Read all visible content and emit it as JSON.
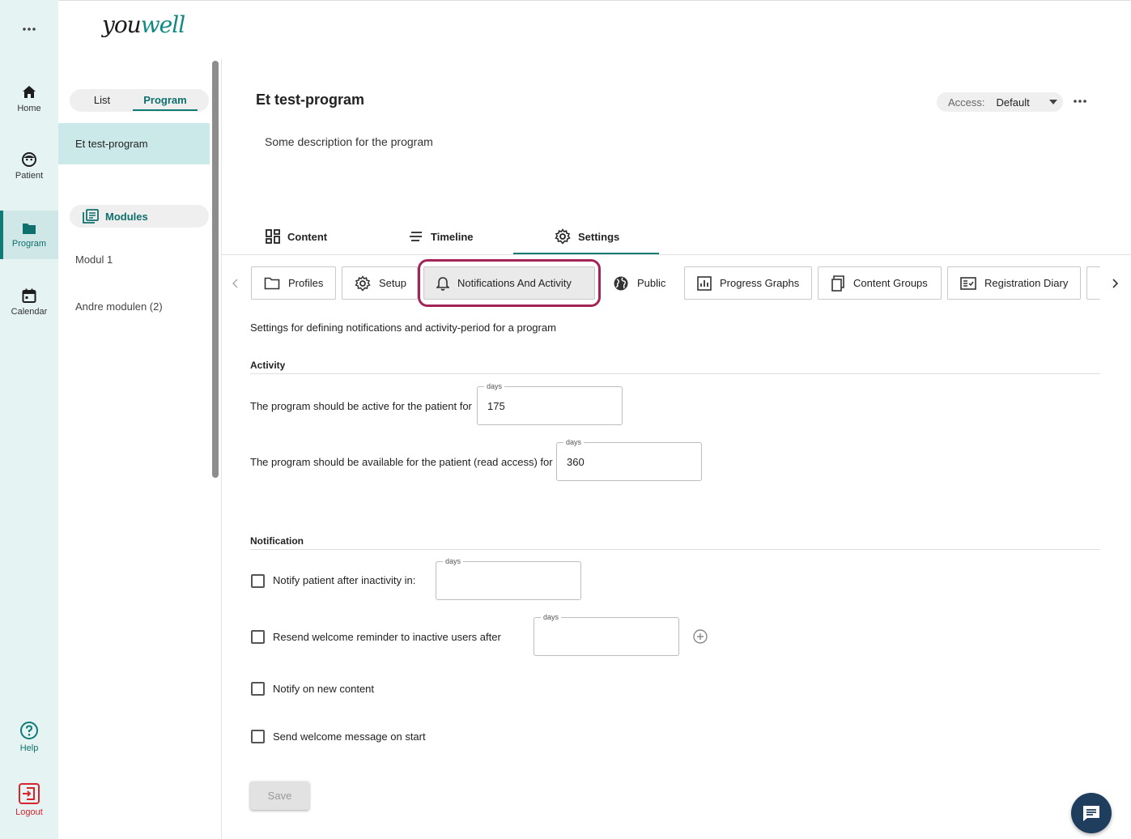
{
  "brand": {
    "logo_text_left": "you",
    "logo_text_right": "well",
    "color_dark": "#1a1a1a",
    "color_accent": "#0f8a83"
  },
  "rail": {
    "items": [
      {
        "label": "Home",
        "icon": "home-icon"
      },
      {
        "label": "Patient",
        "icon": "patient-face-icon"
      },
      {
        "label": "Program",
        "icon": "folder-icon",
        "active": true
      },
      {
        "label": "Calendar",
        "icon": "calendar-icon"
      }
    ],
    "help_label": "Help",
    "logout_label": "Logout"
  },
  "panel": {
    "toggle": {
      "list_label": "List",
      "program_label": "Program",
      "selected": "Program"
    },
    "program_item": "Et test-program",
    "modules_label": "Modules",
    "modules": [
      "Modul 1",
      "Andre modulen (2)"
    ]
  },
  "header": {
    "title": "Et test-program",
    "description": "Some description for the program",
    "access_label": "Access:",
    "access_value": "Default"
  },
  "main_tabs": [
    {
      "label": "Content",
      "icon": "grid-icon"
    },
    {
      "label": "Timeline",
      "icon": "timeline-lines-icon"
    },
    {
      "label": "Settings",
      "icon": "gear-icon",
      "active": true
    }
  ],
  "settings_tabs": [
    {
      "label": "Profiles",
      "icon": "folder-outline-icon"
    },
    {
      "label": "Setup",
      "icon": "gear-icon"
    },
    {
      "label": "Notifications And Activity",
      "icon": "bell-icon",
      "selected": true
    },
    {
      "label": "Public",
      "icon": "globe-icon"
    },
    {
      "label": "Progress Graphs",
      "icon": "bar-graph-icon"
    },
    {
      "label": "Content Groups",
      "icon": "copy-icon"
    },
    {
      "label": "Registration Diary",
      "icon": "checklist-icon"
    }
  ],
  "settings": {
    "description": "Settings for defining notifications and activity-period for a program",
    "activity": {
      "title": "Activity",
      "active_label": "The program should be active for the patient for",
      "active_days": "175",
      "available_label": "The program should be available for the patient (read access) for",
      "available_days": "360",
      "unit": "days"
    },
    "notification": {
      "title": "Notification",
      "inactivity_label": "Notify patient after inactivity in:",
      "inactivity_days": "",
      "resend_label": "Resend welcome reminder to inactive users after",
      "resend_days": "",
      "new_content_label": "Notify on new content",
      "welcome_label": "Send welcome message on start",
      "unit": "days"
    },
    "save_label": "Save"
  },
  "colors": {
    "teal": "#0f7b77",
    "highlight": "#a32558",
    "chat": "#1f3d5c",
    "rail_bg": "#e5f3f2"
  }
}
